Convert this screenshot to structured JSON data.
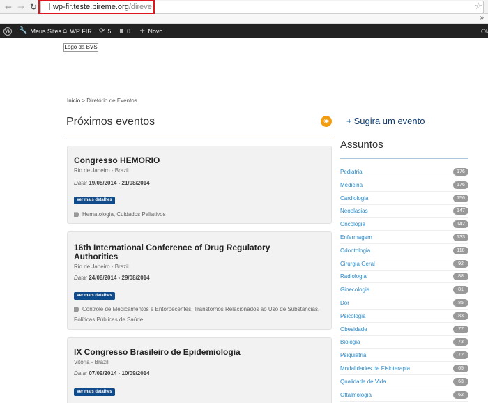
{
  "browser": {
    "url_host": "wp-fir.teste.bireme.org",
    "url_path": "/direve",
    "bookmarks_more": "»"
  },
  "adminbar": {
    "meus_sites": "Meus Sites",
    "site_name": "WP FIR",
    "updates_count": "5",
    "comments_count": "0",
    "new_label": "Novo",
    "greeting": "Olá"
  },
  "logo": {
    "label": "Logo da BVS"
  },
  "breadcrumb": {
    "home": "Início",
    "separator": ">",
    "current": "Diretório de Eventos"
  },
  "page": {
    "title": "Próximos eventos"
  },
  "events": [
    {
      "title": "Congresso HEMORIO",
      "location": "Rio de Janeiro - Brazil",
      "date_label": "Data:",
      "date": "19/08/2014 - 21/08/2014",
      "button": "Ver mais detalhes",
      "tags": "Hematologia, Cuidados Paliativos"
    },
    {
      "title": "16th International Conference of Drug Regulatory Authorities",
      "location": "Rio de Janeiro - Brazil",
      "date_label": "Data:",
      "date": "24/08/2014 - 29/08/2014",
      "button": "Ver mais detalhes",
      "tags": "Controle de Medicamentos e Entorpecentes, Transtornos Relacionados ao Uso de Substâncias, Políticas Públicas de Saúde"
    },
    {
      "title": "IX Congresso Brasileiro de Epidemiologia",
      "location": "Vitória - Brazil",
      "date_label": "Data:",
      "date": "07/09/2014 - 10/09/2014",
      "button": "Ver mais detalhes",
      "tags": ""
    }
  ],
  "sidebar": {
    "suggest_label": "Sugira um evento",
    "subjects_title": "Assuntos",
    "subjects": [
      {
        "name": "Pediatria",
        "count": "176"
      },
      {
        "name": "Medicina",
        "count": "176"
      },
      {
        "name": "Cardiologia",
        "count": "156"
      },
      {
        "name": "Neoplasias",
        "count": "147"
      },
      {
        "name": "Oncologia",
        "count": "142"
      },
      {
        "name": "Enfermagem",
        "count": "133"
      },
      {
        "name": "Odontologia",
        "count": "118"
      },
      {
        "name": "Cirurgia Geral",
        "count": "92"
      },
      {
        "name": "Radiologia",
        "count": "88"
      },
      {
        "name": "Ginecologia",
        "count": "81"
      },
      {
        "name": "Dor",
        "count": "85"
      },
      {
        "name": "Psicologia",
        "count": "83"
      },
      {
        "name": "Obesidade",
        "count": "77"
      },
      {
        "name": "Biologia",
        "count": "73"
      },
      {
        "name": "Psiquiatria",
        "count": "72"
      },
      {
        "name": "Modalidades de Fisioterapia",
        "count": "65"
      },
      {
        "name": "Qualidade de Vida",
        "count": "63"
      },
      {
        "name": "Oftalmologia",
        "count": "62"
      }
    ]
  }
}
